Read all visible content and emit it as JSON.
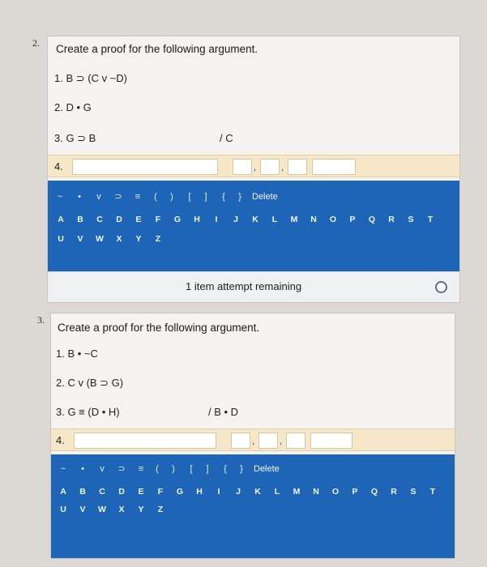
{
  "questions": [
    {
      "number": "2.",
      "title": "Create a proof for the following argument.",
      "premises": [
        "1.  B ⊃ (C v ~D)",
        "2.  D • G",
        "3.  G ⊃ B"
      ],
      "conclusion": "/ C",
      "input_line": "4.",
      "symbols": [
        "~",
        "•",
        "v",
        "⊃",
        "≡",
        "(",
        ")",
        "[",
        "]",
        "{",
        "}"
      ],
      "delete_label": "Delete",
      "letters_row1": [
        "A",
        "B",
        "C",
        "D",
        "E",
        "F",
        "G",
        "H",
        "I",
        "J",
        "K",
        "L",
        "M",
        "N",
        "O",
        "P",
        "Q",
        "R",
        "S",
        "T"
      ],
      "letters_row2": [
        "U",
        "V",
        "W",
        "X",
        "Y",
        "Z"
      ],
      "attempts_text": "1 item attempt remaining"
    },
    {
      "number": "3.",
      "title": "Create a proof for the following argument.",
      "premises": [
        "1.  B • ~C",
        "2.  C v (B ⊃ G)",
        "3.  G ≡ (D • H)"
      ],
      "conclusion": "/ B • D",
      "input_line": "4.",
      "symbols": [
        "~",
        "•",
        "v",
        "⊃",
        "≡",
        "(",
        ")",
        "[",
        "]",
        "{",
        "}"
      ],
      "delete_label": "Delete",
      "letters_row1": [
        "A",
        "B",
        "C",
        "D",
        "E",
        "F",
        "G",
        "H",
        "I",
        "J",
        "K",
        "L",
        "M",
        "N",
        "O",
        "P",
        "Q",
        "R",
        "S",
        "T"
      ],
      "letters_row2": [
        "U",
        "V",
        "W",
        "X",
        "Y",
        "Z"
      ]
    }
  ],
  "colors": {
    "keypad": "#1f65b7",
    "input_band": "#f6e7c8",
    "card": "#f4f3f1"
  }
}
